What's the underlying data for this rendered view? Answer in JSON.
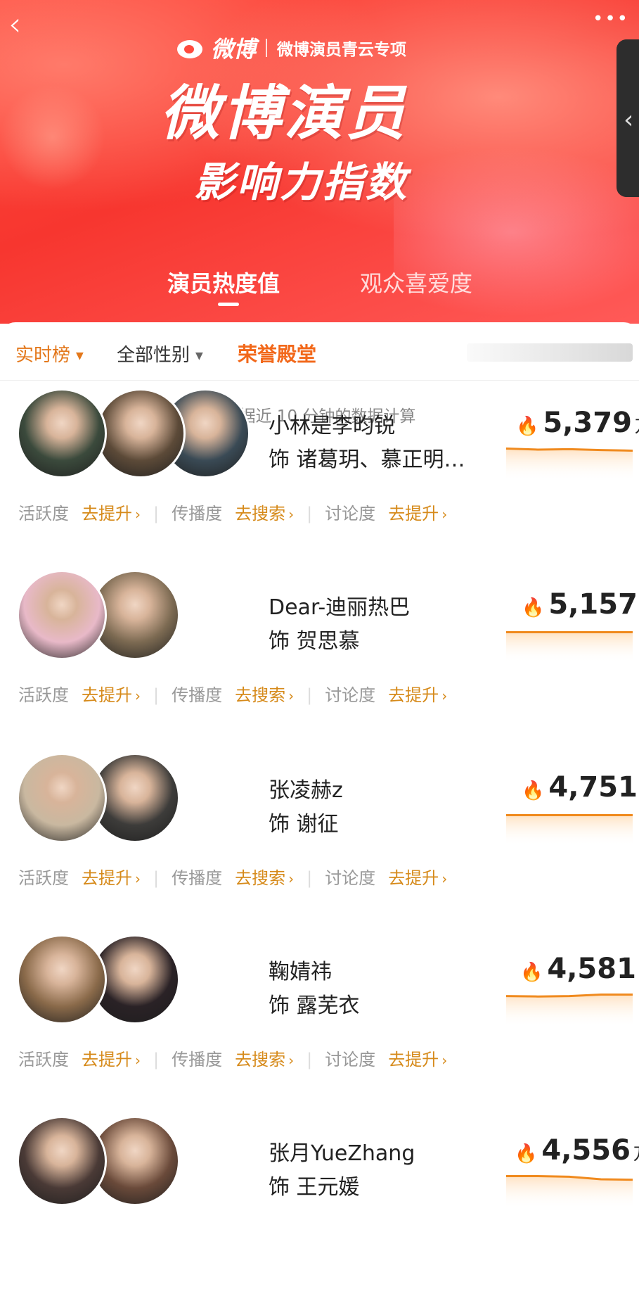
{
  "nav": {
    "back_icon": "‹",
    "more_icon": "•••",
    "side_icon": "‹"
  },
  "brand": {
    "weibo": "微博",
    "subtitle": "微博演员青云专项"
  },
  "hero": {
    "title": "微博演员",
    "subtitle": "影响力指数"
  },
  "tabs": [
    {
      "label": "演员热度值"
    },
    {
      "label": "观众喜爱度"
    }
  ],
  "filters": {
    "realtime": "实时榜",
    "gender": "全部性别",
    "honor": "荣誉殿堂"
  },
  "note": "根据近 10 分钟的数据计算",
  "metric_labels": {
    "activity": "活跃度",
    "spread": "传播度",
    "discussion": "讨论度"
  },
  "metric_actions": {
    "improve": "去提升",
    "search": "去搜索"
  },
  "score_unit": "万",
  "actors": [
    {
      "name": "小林是李昀锐",
      "role": "饰 诸葛玥、慕正明…",
      "score": "5,379",
      "avatars": [
        "#3b4a3c",
        "#5c4a38",
        "#3a4a55"
      ],
      "trend": [
        0.55,
        0.5,
        0.52,
        0.48,
        0.45
      ]
    },
    {
      "name": "Dear-迪丽热巴",
      "role": "饰 贺思慕",
      "score": "5,157",
      "avatars": [
        "#e8b9c8",
        "#7c6a52"
      ],
      "trend": [
        0.45,
        0.45,
        0.45,
        0.45,
        0.45
      ]
    },
    {
      "name": "张凌赫z",
      "role": "饰 谢征",
      "score": "4,751",
      "avatars": [
        "#c9b8a0",
        "#3d3c3a"
      ],
      "trend": [
        0.45,
        0.45,
        0.45,
        0.45,
        0.45
      ]
    },
    {
      "name": "鞠婧祎",
      "role": "饰 露芜衣",
      "score": "4,581",
      "avatars": [
        "#8a6a4a",
        "#2a2226"
      ],
      "trend": [
        0.48,
        0.46,
        0.48,
        0.55,
        0.55
      ]
    },
    {
      "name": "张月YueZhang",
      "role": "饰 王元媛",
      "score": "4,556",
      "avatars": [
        "#4a3a36",
        "#6a4a3a"
      ],
      "trend": [
        0.55,
        0.55,
        0.52,
        0.4,
        0.38
      ]
    }
  ],
  "colors": {
    "accent": "#ff4a3d",
    "orange": "#f2681a",
    "gold": "#d68a1a"
  }
}
